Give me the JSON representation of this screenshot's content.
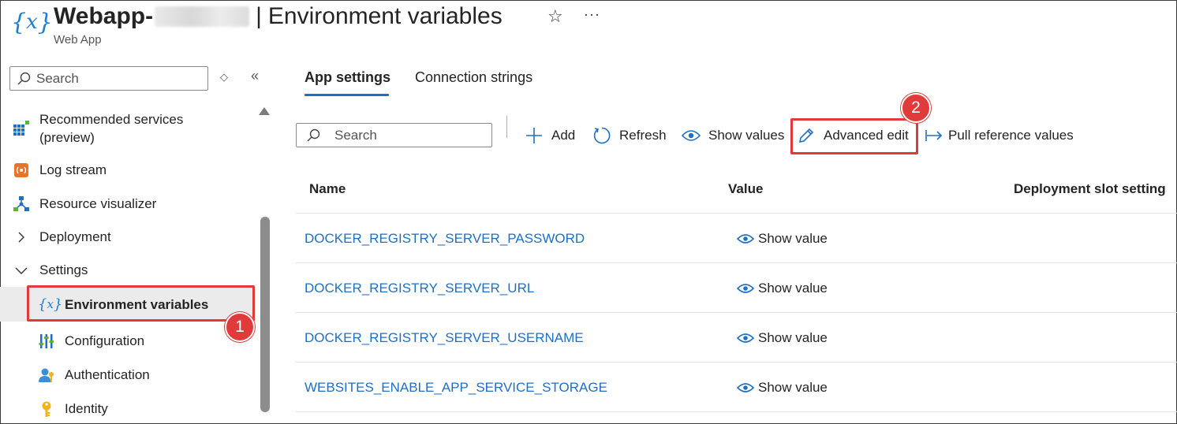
{
  "header": {
    "app_name": "Webapp-",
    "separator": "|",
    "page_title": "Environment variables",
    "subtitle": "Web App",
    "favorite_icon": "star-icon",
    "more_icon": "ellipsis-icon",
    "resource_icon": "variable-braces-icon"
  },
  "sidebar": {
    "search_placeholder": "Search",
    "items": [
      {
        "label": "Recommended services (preview)",
        "icon": "grid-plus-icon"
      },
      {
        "label": "Log stream",
        "icon": "log-stream-icon"
      },
      {
        "label": "Resource visualizer",
        "icon": "hierarchy-icon"
      },
      {
        "label": "Deployment",
        "icon": "chevron-right-icon",
        "expanded": false
      },
      {
        "label": "Settings",
        "icon": "chevron-down-icon",
        "expanded": true
      },
      {
        "label": "Environment variables",
        "icon": "variable-braces-icon",
        "selected": true
      },
      {
        "label": "Configuration",
        "icon": "sliders-icon"
      },
      {
        "label": "Authentication",
        "icon": "user-key-icon"
      },
      {
        "label": "Identity",
        "icon": "key-icon"
      }
    ]
  },
  "tabs": [
    {
      "label": "App settings",
      "active": true
    },
    {
      "label": "Connection strings",
      "active": false
    }
  ],
  "toolbar": {
    "search_placeholder": "Search",
    "add_label": "Add",
    "refresh_label": "Refresh",
    "show_values_label": "Show values",
    "advanced_edit_label": "Advanced edit",
    "pull_reference_label": "Pull reference values"
  },
  "table": {
    "columns": [
      "Name",
      "Value",
      "Deployment slot setting"
    ],
    "rows": [
      {
        "name": "DOCKER_REGISTRY_SERVER_PASSWORD",
        "value": "Show value",
        "slot": ""
      },
      {
        "name": "DOCKER_REGISTRY_SERVER_URL",
        "value": "Show value",
        "slot": ""
      },
      {
        "name": "DOCKER_REGISTRY_SERVER_USERNAME",
        "value": "Show value",
        "slot": ""
      },
      {
        "name": "WEBSITES_ENABLE_APP_SERVICE_STORAGE",
        "value": "Show value",
        "slot": ""
      }
    ]
  },
  "annotations": {
    "step_1": "1",
    "step_2": "2",
    "highlight_color": "#e03a3a"
  },
  "colors": {
    "accent": "#1f6fc5",
    "icon_blue": "#1f7fd1",
    "selected_bg": "#ebebeb"
  }
}
